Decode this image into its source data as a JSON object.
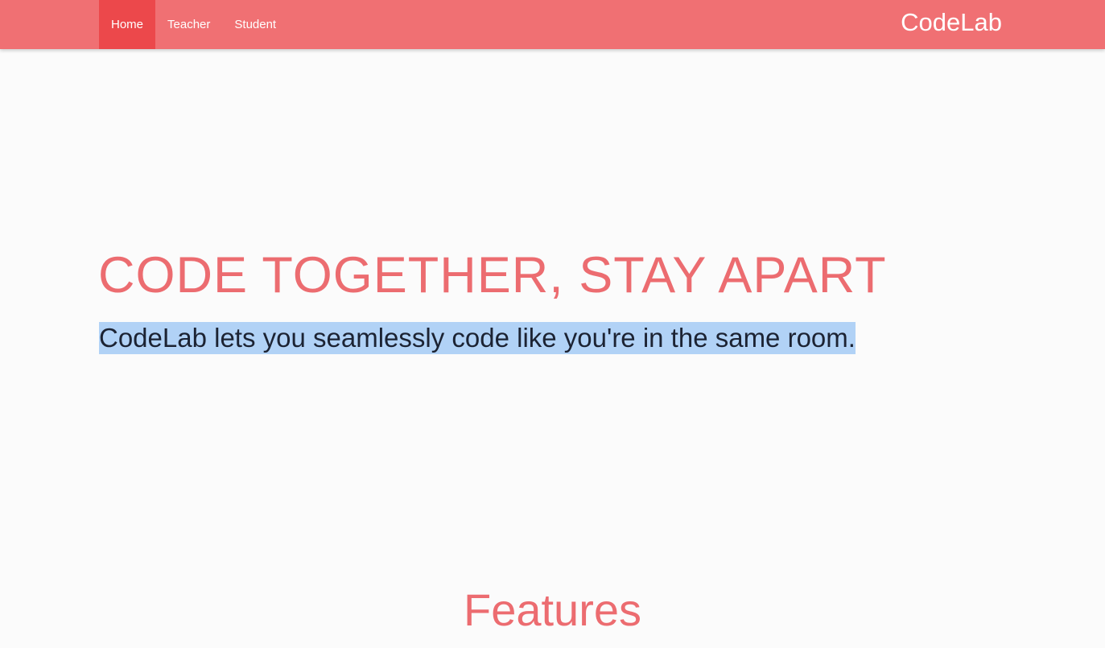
{
  "navbar": {
    "items": [
      {
        "label": "Home",
        "active": true
      },
      {
        "label": "Teacher",
        "active": false
      },
      {
        "label": "Student",
        "active": false
      }
    ],
    "brand": "CodeLab"
  },
  "hero": {
    "title": "CODE TOGETHER, STAY APART",
    "subtitle": "CodeLab lets you seamlessly code like you're in the same room."
  },
  "features": {
    "title": "Features"
  },
  "colors": {
    "navbar": "#f07073",
    "nav_active": "#ec484b",
    "accent_text": "#ec6c70",
    "selection_highlight": "#b1d2f6",
    "page_background": "#fbfbfb"
  }
}
